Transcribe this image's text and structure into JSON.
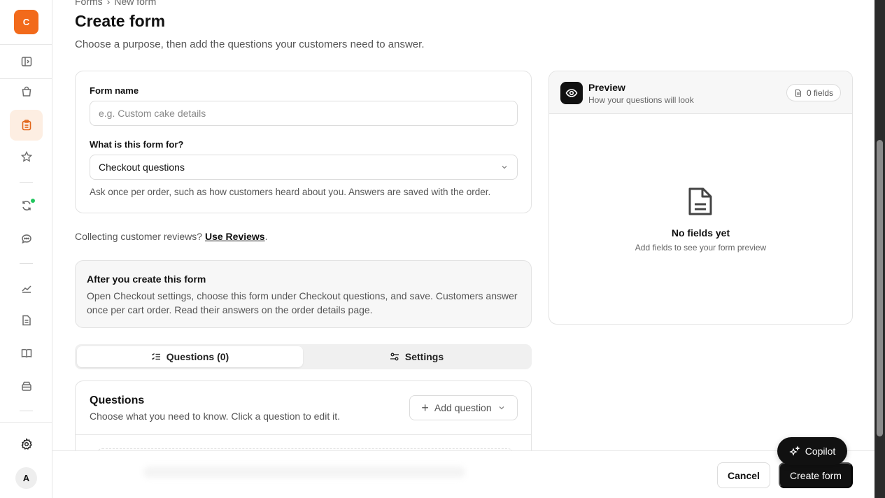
{
  "app": {
    "logo_letter": "C"
  },
  "sidebar": {
    "items": [
      {
        "name": "panel-toggle-icon"
      },
      {
        "name": "shopping-bag-icon"
      },
      {
        "name": "clipboard-icon",
        "active": true
      },
      {
        "name": "star-icon"
      },
      {
        "name": "refresh-icon",
        "badge": "green-dot"
      },
      {
        "name": "chat-icon"
      },
      {
        "name": "chart-icon"
      },
      {
        "name": "document-icon"
      },
      {
        "name": "book-icon"
      },
      {
        "name": "archive-icon"
      },
      {
        "name": "gear-icon"
      }
    ],
    "avatar_letter": "A"
  },
  "breadcrumb": {
    "parent": "Forms",
    "separator": "›",
    "current": "New form"
  },
  "page": {
    "title": "Create form",
    "subtitle": "Choose a purpose, then add the questions your customers need to answer."
  },
  "form": {
    "name_label": "Form name",
    "name_placeholder": "e.g. Custom cake details",
    "name_value": "",
    "purpose_label": "What is this form for?",
    "purpose_value": "Checkout questions",
    "purpose_helper": "Ask once per order, such as how customers heard about you. Answers are saved with the order."
  },
  "reviews": {
    "text": "Collecting customer reviews?",
    "link": "Use Reviews",
    "suffix": "."
  },
  "info": {
    "title": "After you create this form",
    "body": "Open Checkout settings, choose this form under Checkout questions, and save. Customers answer once per cart order. Read their answers on the order details page."
  },
  "tabs": {
    "questions": "Questions (0)",
    "settings": "Settings"
  },
  "questions": {
    "title": "Questions",
    "subtitle": "Choose what you need to know. Click a question to edit it.",
    "add_button": "Add question"
  },
  "preview": {
    "title": "Preview",
    "subtitle": "How your questions will look",
    "fields_count": "0 fields",
    "empty_title": "No fields yet",
    "empty_subtitle": "Add fields to see your form preview"
  },
  "footer": {
    "cancel": "Cancel",
    "create": "Create form"
  },
  "copilot": {
    "label": "Copilot"
  },
  "colors": {
    "brand": "#f26a1b",
    "active_bg": "#fdeee2",
    "primary_button": "#111111",
    "status_dot": "#22c55e"
  }
}
